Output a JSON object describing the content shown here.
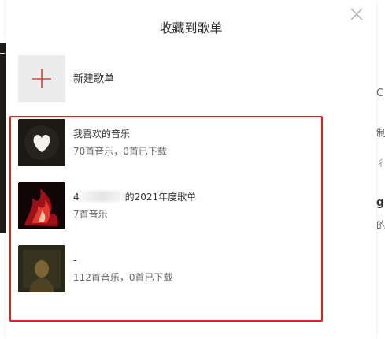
{
  "background": {
    "fragments": [
      "C",
      "制",
      "g",
      "的",
      "彳"
    ]
  },
  "modal": {
    "title": "收藏到歌单",
    "close_icon": "close-icon",
    "new_playlist": {
      "label": "新建歌单",
      "icon": "plus-icon"
    },
    "playlists": [
      {
        "name": "我喜欢的音乐",
        "meta": "70首音乐，0首已下载",
        "cover_icon": "heart-icon"
      },
      {
        "name_prefix": "4",
        "name_suffix": "的2021年度歌单",
        "meta": "7首音乐",
        "cover_icon": "flame-icon"
      },
      {
        "name": "-",
        "meta": "112首音乐，0首已下载",
        "cover_icon": "portrait-icon"
      }
    ]
  },
  "colors": {
    "accent_red": "#e02020",
    "plus_red": "#e33e3e",
    "cover_gray": "#ececec"
  }
}
